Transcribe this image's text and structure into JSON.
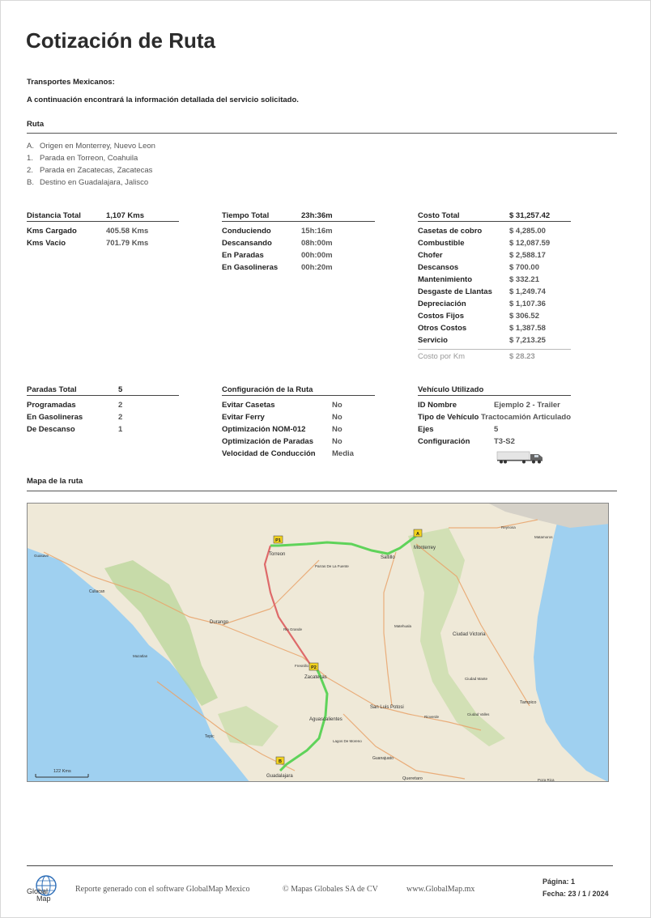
{
  "title": "Cotización de Ruta",
  "company": "Transportes Mexicanos:",
  "intro_text": "A continuación encontrará la información detallada del servicio solicitado.",
  "route": {
    "heading": "Ruta",
    "stops": [
      {
        "marker": "A.",
        "text": "Origen en Monterrey, Nuevo Leon"
      },
      {
        "marker": "1.",
        "text": "Parada en Torreon, Coahuila"
      },
      {
        "marker": "2.",
        "text": "Parada en Zacatecas, Zacatecas"
      },
      {
        "marker": "B.",
        "text": "Destino en Guadalajara, Jalisco"
      }
    ]
  },
  "distance": {
    "label": "Distancia Total",
    "value": "1,107 Kms",
    "rows": [
      {
        "k": "Kms Cargado",
        "v": "405.58 Kms"
      },
      {
        "k": "Kms Vacio",
        "v": "701.79 Kms"
      }
    ]
  },
  "time": {
    "label": "Tiempo Total",
    "value": "23h:36m",
    "rows": [
      {
        "k": "Conduciendo",
        "v": "15h:16m"
      },
      {
        "k": "Descansando",
        "v": "08h:00m"
      },
      {
        "k": "En Paradas",
        "v": "00h:00m"
      },
      {
        "k": "En Gasolineras",
        "v": "00h:20m"
      }
    ]
  },
  "cost": {
    "label": "Costo Total",
    "value": "$ 31,257.42",
    "rows": [
      {
        "k": "Casetas de cobro",
        "v": "$ 4,285.00"
      },
      {
        "k": "Combustible",
        "v": "$ 12,087.59"
      },
      {
        "k": "Chofer",
        "v": "$ 2,588.17"
      },
      {
        "k": "Descansos",
        "v": "$ 700.00"
      },
      {
        "k": "Mantenimiento",
        "v": "$ 332.21"
      },
      {
        "k": "Desgaste de Llantas",
        "v": "$ 1,249.74"
      },
      {
        "k": "Depreciación",
        "v": "$ 1,107.36"
      },
      {
        "k": "Costos Fijos",
        "v": "$ 306.52"
      },
      {
        "k": "Otros Costos",
        "v": "$ 1,387.58"
      },
      {
        "k": "Servicio",
        "v": "$ 7,213.25"
      }
    ],
    "per_km_label": "Costo por Km",
    "per_km_value": "$ 28.23"
  },
  "stops_summary": {
    "label": "Paradas Total",
    "value": "5",
    "rows": [
      {
        "k": "Programadas",
        "v": "2"
      },
      {
        "k": "En Gasolineras",
        "v": "2"
      },
      {
        "k": "De Descanso",
        "v": "1"
      }
    ]
  },
  "config": {
    "label": "Configuración de la Ruta",
    "rows": [
      {
        "k": "Evitar Casetas",
        "v": "No"
      },
      {
        "k": "Evitar Ferry",
        "v": "No"
      },
      {
        "k": "Optimización NOM-012",
        "v": "No"
      },
      {
        "k": "Optimización de Paradas",
        "v": "No"
      },
      {
        "k": "Velocidad de Conducción",
        "v": "Media"
      }
    ]
  },
  "vehicle": {
    "label": "Vehículo Utilizado",
    "rows": [
      {
        "k": "ID Nombre",
        "v": "Ejemplo 2 - Trailer"
      },
      {
        "k": "Tipo de Vehículo",
        "v": "Tractocamión Articulado"
      },
      {
        "k": "Ejes",
        "v": "5"
      },
      {
        "k": "Configuración",
        "v": "T3-S2"
      }
    ],
    "icon": "truck-icon"
  },
  "map": {
    "heading": "Mapa de la ruta",
    "scale_label": "122 Kms",
    "cities": {
      "monterrey": "Monterrey",
      "saltillo": "Saltillo",
      "torreon": "Torreon",
      "parras": "Parras De La Fuente",
      "durango": "Durango",
      "culiacan": "Culiacan",
      "guasave": "Guasave",
      "mazatlan": "Mazatlan",
      "zacatecas": "Zacatecas",
      "aguascalientes": "Aguascalientes",
      "slp": "San Luis Potosi",
      "guadalajara": "Guadalajara",
      "tepic": "Tepic",
      "queretaro": "Queretaro",
      "guanajuato": "Guanajuato",
      "cd_victoria": "Ciudad Victoria",
      "cd_mante": "Ciudad Mante",
      "tampico": "Tampico",
      "reynosa": "Reynosa",
      "matamoros": "Matamoros",
      "matehuala": "Matehuala",
      "rio_grande": "Rio Grande",
      "fresnillo": "Fresnillo",
      "lagos": "Lagos De Moreno",
      "rioverde": "Rioverde",
      "ciudad_valles": "Ciudad Valles",
      "poza_rica": "Poza Rica"
    },
    "markers": {
      "a": "A",
      "p1": "P1",
      "p2": "P2",
      "b": "B"
    },
    "colors": {
      "route": "#5fd35a",
      "land": "#efe9d8",
      "water": "#9fd0f0",
      "forest": "#b9d59a",
      "road": "#e9a36a"
    }
  },
  "footer": {
    "logo_top": "Global",
    "logo_bottom": "Map",
    "generated": "Reporte generado con el software GlobalMap Mexico",
    "copyright": "© Mapas Globales SA de CV",
    "website": "www.GlobalMap.mx",
    "page": "Página: 1",
    "date": "Fecha: 23 / 1 / 2024"
  }
}
